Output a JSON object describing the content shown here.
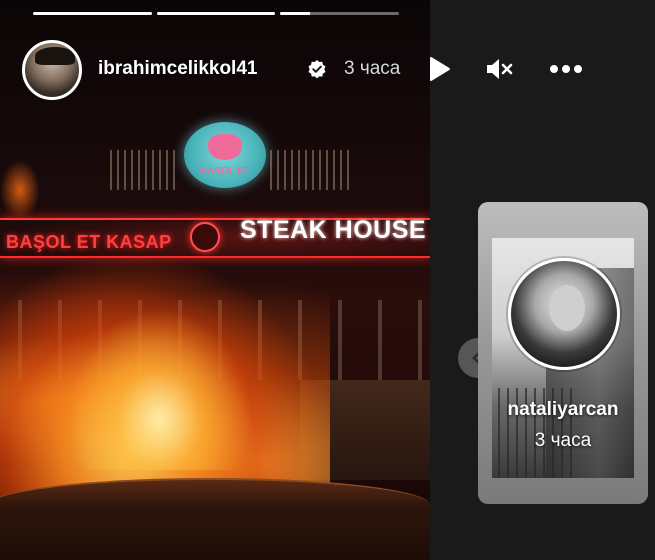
{
  "story": {
    "username": "ibrahimcelikkol41",
    "time_ago": "3 часа",
    "progress": [
      1.0,
      1.0,
      0.25
    ],
    "sign_left_text": "BAŞOL ET KASAP",
    "sign_right_text": "STEAK HOUSE",
    "logo_text": "BAŞOL ET"
  },
  "controls": {
    "play_icon": "play-icon",
    "mute_icon": "mute-icon",
    "more_icon": "more-icon"
  },
  "next_story": {
    "username": "nataliyarcan",
    "time_ago": "3 часа"
  },
  "colors": {
    "background": "#1a1a1a",
    "verified": "#ffffff",
    "neon_red": "#ff3a3a"
  }
}
